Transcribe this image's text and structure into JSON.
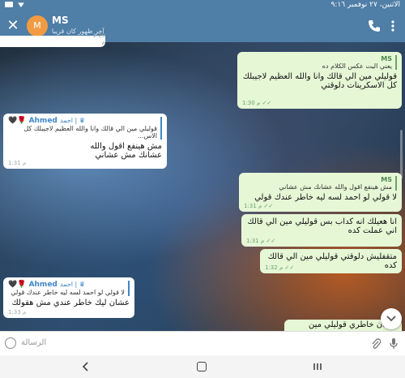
{
  "status": {
    "datetime": "الاثنين، ٢٧ نوفمبر  ٩:١٦"
  },
  "header": {
    "title": "MS",
    "avatar_letter": "M",
    "subtitle": "آخر ظهور كان قريبا"
  },
  "messages": [
    {
      "type": "out",
      "reply_name": "MS",
      "reply_text": "يعني اليت عكس الكلام ده",
      "text": "قوليلي مين الي قالك وانا والله العظيم لاجيبلك كل الاسكرينات دلوقتي",
      "time": "1:30 م"
    },
    {
      "type": "in",
      "sender": "Ahmed",
      "role": "احمد | ♛",
      "reply_text": "قوليلي مين الي قالك وانا والله العظيم لاجيبلك كل الاس...",
      "text": "مش هينفع اقول والله\nعشانك مش عشاني",
      "time": "1:31 م"
    },
    {
      "type": "out",
      "reply_name": "MS",
      "reply_text": "مش هينفع اقول والله عشانك مش عشاني",
      "text": "لا قولي لو احمد لسه ليه خاطر عندك قولي",
      "time": "1:31 م"
    },
    {
      "type": "out",
      "text": "انا هعيلك انه كداب بس قوليلي مين الي قالك اني عملت كده",
      "time": "1:31 م"
    },
    {
      "type": "out",
      "text": "متقفليش دلوقتي قوليلي مين الي قالك كده",
      "time": "1:32 م"
    },
    {
      "type": "in",
      "sender": "Ahmed",
      "role": "احمد | ♛",
      "reply_text": "لا قولي لو احمد لسه ليه خاطر عندك قولي",
      "text": "عشان ليك خاطر عندي مش هقولك",
      "time": "1:33 م"
    },
    {
      "type": "out",
      "text": "عشان خاطري قوليلي مين",
      "time": ""
    }
  ],
  "top_partial_time": "1:29 م",
  "input": {
    "placeholder": "الرسالة"
  },
  "icons": [
    "close-icon",
    "phone-icon",
    "more-icon",
    "emoji-icon",
    "attach-icon",
    "mic-icon",
    "back-icon",
    "home-icon",
    "recent-icon",
    "chevron-down-icon"
  ]
}
